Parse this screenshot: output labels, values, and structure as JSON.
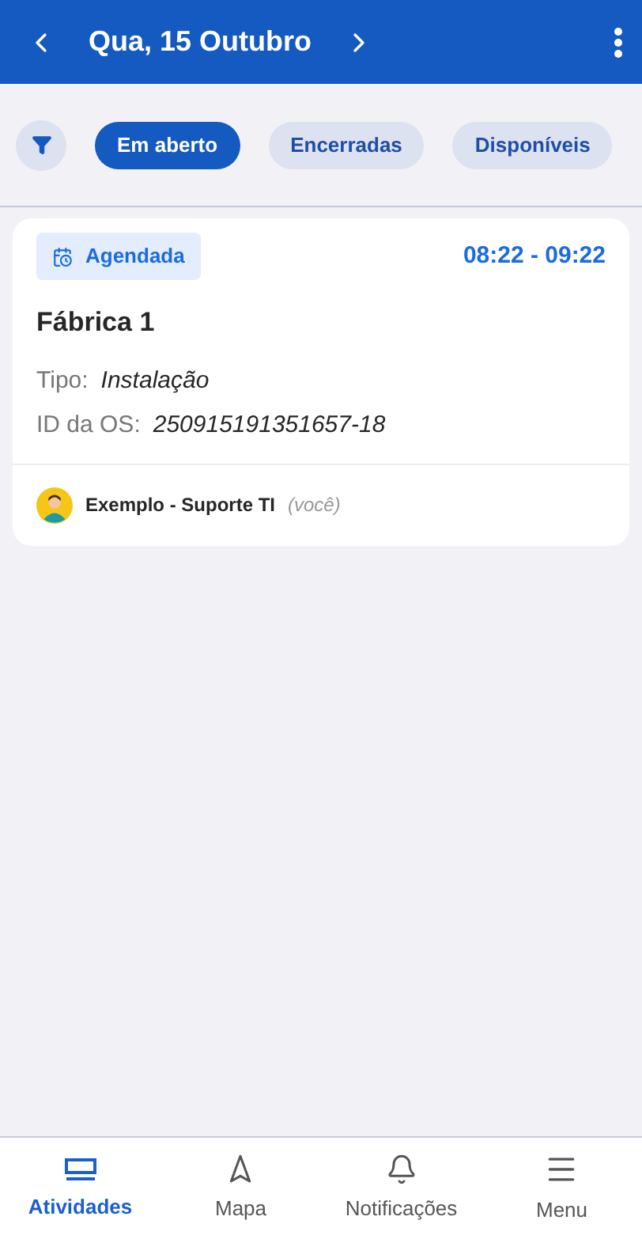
{
  "header": {
    "title": "Qua, 15 Outubro"
  },
  "filters": [
    {
      "label": "Em aberto",
      "selected": true
    },
    {
      "label": "Encerradas",
      "selected": false
    },
    {
      "label": "Disponíveis",
      "selected": false
    }
  ],
  "activities": [
    {
      "status": "Agendada",
      "time": "08:22 - 09:22",
      "title": "Fábrica 1",
      "fields": [
        {
          "label": "Tipo:",
          "value": "Instalação"
        },
        {
          "label": "ID da OS:",
          "value": "250915191351657-18"
        }
      ],
      "assignee": "Exemplo - Suporte TI",
      "assignee_note": "(você)"
    }
  ],
  "nav": [
    {
      "kind": "activities",
      "label": "Atividades",
      "selected": true
    },
    {
      "kind": "map",
      "label": "Mapa",
      "selected": false
    },
    {
      "kind": "notifications",
      "label": "Notificações",
      "selected": false
    },
    {
      "kind": "menu",
      "label": "Menu",
      "selected": false
    }
  ]
}
